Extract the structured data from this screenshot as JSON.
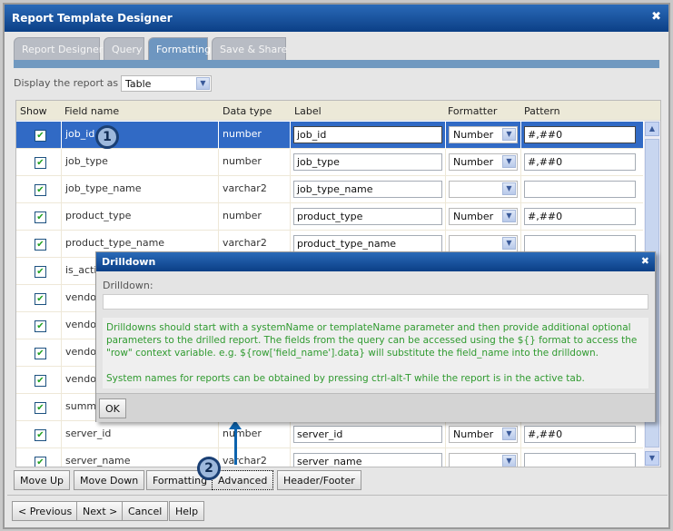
{
  "window": {
    "title": "Report Template Designer",
    "close": "✖"
  },
  "tabs": [
    {
      "label": "Report Designer",
      "active": false
    },
    {
      "label": "Query",
      "active": false
    },
    {
      "label": "Formatting",
      "active": true
    },
    {
      "label": "Save & Share",
      "active": false
    }
  ],
  "display": {
    "label": "Display the report as a:",
    "value": "Table"
  },
  "columns": {
    "show": "Show",
    "field": "Field name",
    "type": "Data type",
    "label": "Label",
    "formatter": "Formatter",
    "pattern": "Pattern"
  },
  "rows": [
    {
      "field": "job_id",
      "type": "number",
      "label": "job_id",
      "formatter": "Number",
      "pattern": "#,##0",
      "selected": true
    },
    {
      "field": "job_type",
      "type": "number",
      "label": "job_type",
      "formatter": "Number",
      "pattern": "#,##0"
    },
    {
      "field": "job_type_name",
      "type": "varchar2",
      "label": "job_type_name",
      "formatter": "",
      "pattern": ""
    },
    {
      "field": "product_type",
      "type": "number",
      "label": "product_type",
      "formatter": "Number",
      "pattern": "#,##0"
    },
    {
      "field": "product_type_name",
      "type": "varchar2",
      "label": "product_type_name",
      "formatter": "",
      "pattern": ""
    },
    {
      "field": "is_activ",
      "covered": true
    },
    {
      "field": "vendor",
      "covered": true
    },
    {
      "field": "vendor",
      "covered": true
    },
    {
      "field": "vendor",
      "covered": true
    },
    {
      "field": "vendor",
      "covered": true
    },
    {
      "field": "summa",
      "covered": true
    },
    {
      "field": "server_id",
      "type": "number",
      "label": "server_id",
      "formatter": "Number",
      "pattern": "#,##0"
    },
    {
      "field": "server_name",
      "type": "varchar2",
      "label": "server_name",
      "formatter": "",
      "pattern": ""
    }
  ],
  "actions": {
    "move_up": "Move Up",
    "move_down": "Move Down",
    "formatting": "Formatting",
    "advanced": "Advanced",
    "header_footer": "Header/Footer"
  },
  "nav": {
    "previous": "< Previous",
    "next": "Next >",
    "cancel": "Cancel",
    "help": "Help"
  },
  "callouts": {
    "one": "1",
    "two": "2"
  },
  "dialog": {
    "title": "Drilldown",
    "close": "✖",
    "field_label": "Drilldown:",
    "field_value": "",
    "help1": "Drilldowns should start with a systemName or templateName parameter and then provide additional optional parameters to the drilled report. The fields from the query can be accessed using the ${} format to access the \"row\" context variable. e.g. ${row['field_name'].data} will substitute the field_name into the drilldown.",
    "help2": "System names for reports can be obtained by pressing ctrl-alt-T while the report is in the active tab.",
    "ok": "OK"
  },
  "colors": {
    "accent": "#316ac5",
    "title_bar": "#0b3f86",
    "help_text": "#2f9a2f"
  }
}
